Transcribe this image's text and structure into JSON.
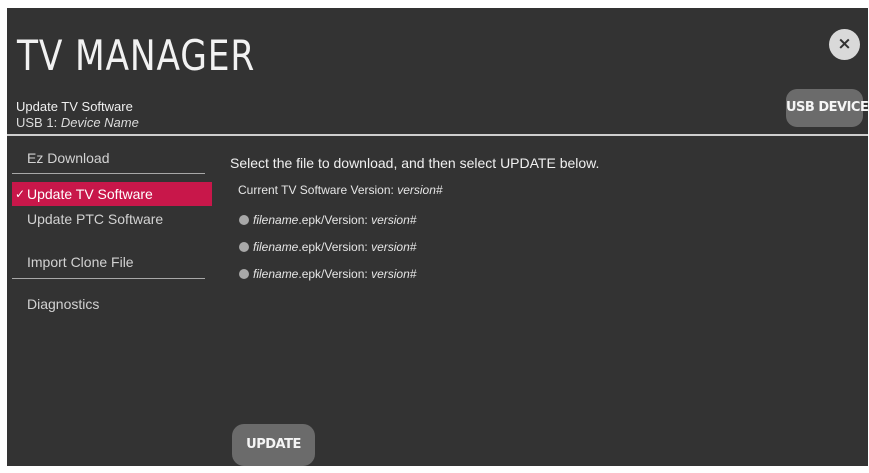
{
  "header": {
    "title": "TV MANAGER",
    "subtitle": "Update TV Software",
    "device_prefix": "USB 1:",
    "device_name": "Device Name",
    "close_glyph": "×",
    "usb_device_label": "USB DEVICE"
  },
  "sidebar": {
    "items": [
      {
        "label": "Ez Download",
        "selected": false
      },
      {
        "label": "Update TV Software",
        "selected": true
      },
      {
        "label": "Update PTC Software",
        "selected": false
      },
      {
        "label": "Import Clone File",
        "selected": false
      },
      {
        "label": "Diagnostics",
        "selected": false
      }
    ],
    "check_glyph": "✓"
  },
  "main": {
    "instruction": "Select the file to download, and then select UPDATE below.",
    "current_version_label": "Current TV Software Version:",
    "current_version_value": "version#",
    "files": [
      {
        "filename": "filename",
        "ext": ".epk/Version:",
        "version": "version#"
      },
      {
        "filename": "filename",
        "ext": ".epk/Version:",
        "version": "version#"
      },
      {
        "filename": "filename",
        "ext": ".epk/Version:",
        "version": "version#"
      }
    ],
    "update_label": "UPDATE"
  },
  "colors": {
    "background": "#333333",
    "accent": "#c8174a",
    "button": "#6b6b6b"
  },
  "icons": {
    "close": "close-icon",
    "check": "check-icon",
    "radio": "radio-icon"
  }
}
